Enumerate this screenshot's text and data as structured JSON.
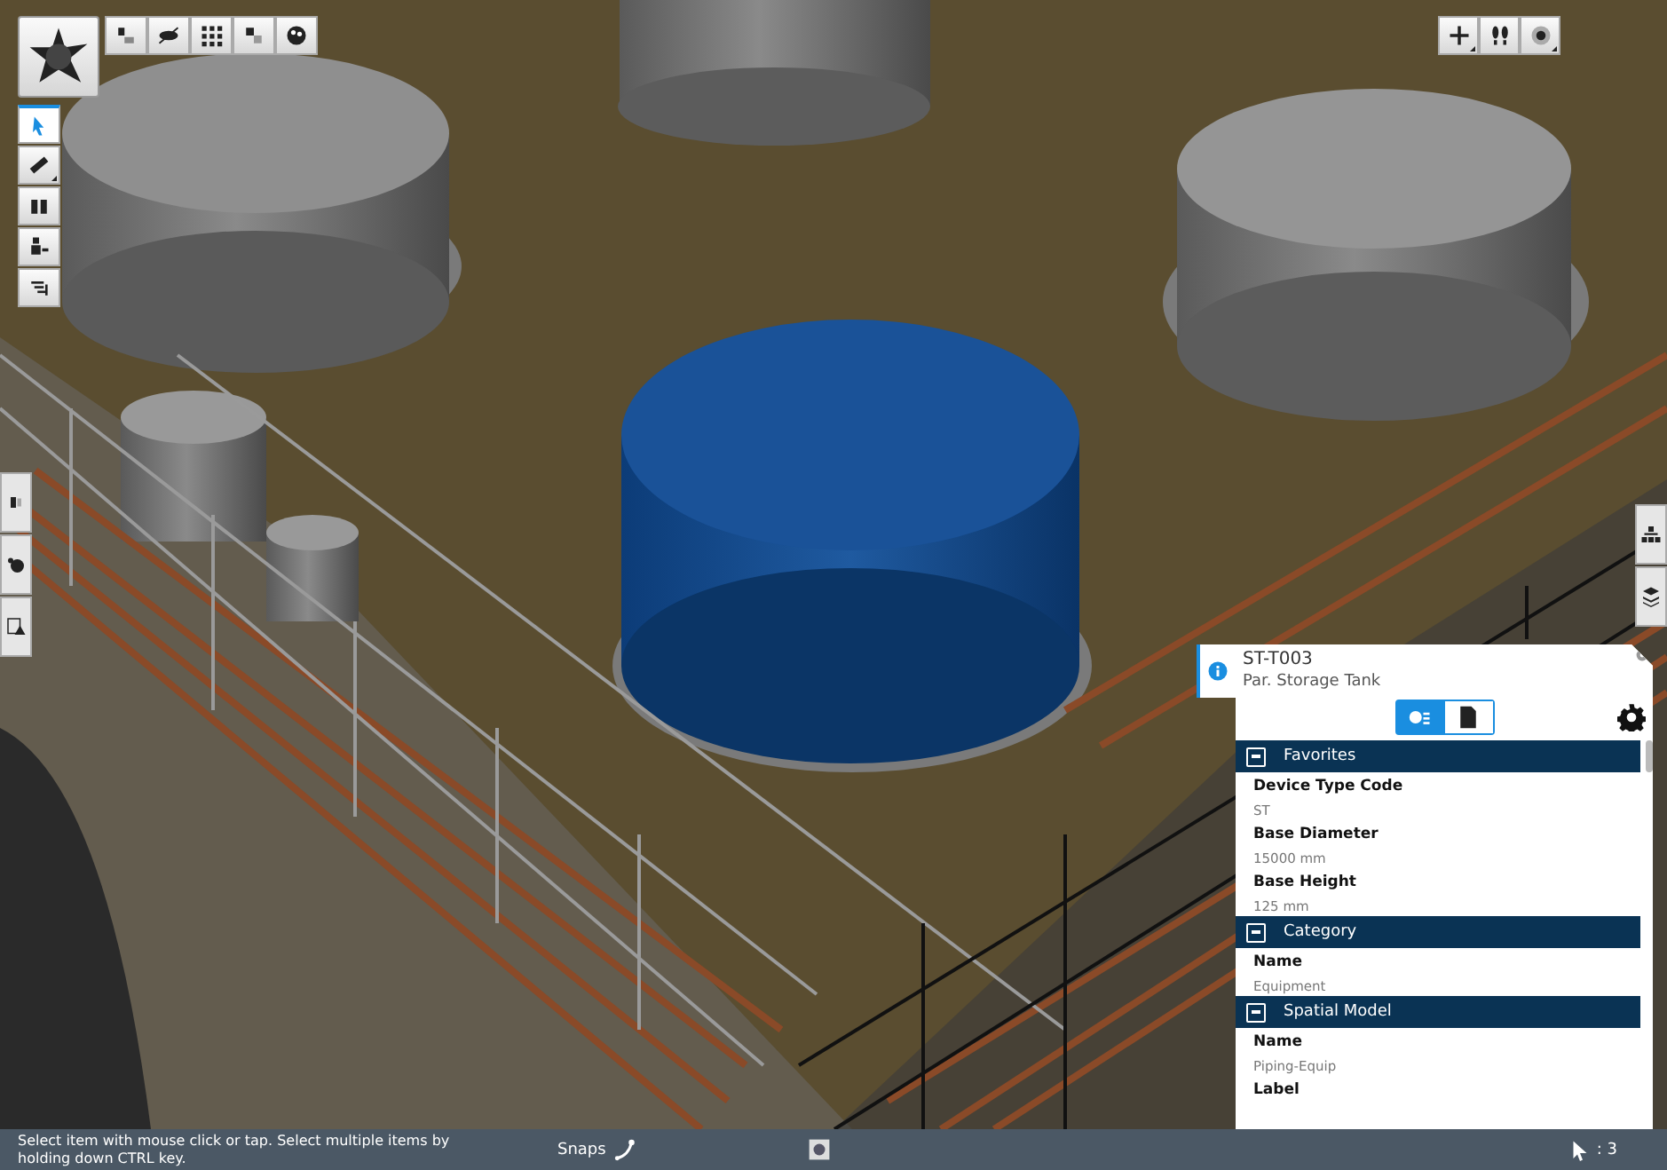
{
  "top_toolbar": [
    {
      "has_menu": false
    },
    {
      "has_menu": false
    },
    {
      "has_menu": false
    },
    {
      "has_menu": false
    },
    {
      "has_menu": false
    }
  ],
  "left_toolbar": [
    {
      "selected": true,
      "has_menu": false
    },
    {
      "selected": false,
      "has_menu": true
    },
    {
      "selected": false,
      "has_menu": false
    },
    {
      "selected": false,
      "has_menu": false
    },
    {
      "selected": false,
      "has_menu": false
    }
  ],
  "left_side_tabs": [
    {
      "selected": false
    },
    {
      "selected": false
    },
    {
      "selected": false
    }
  ],
  "right_side_tabs": [
    {
      "selected": false
    },
    {
      "selected": false
    }
  ],
  "view_toolbar": [
    {
      "has_menu": true
    },
    {
      "has_menu": false
    },
    {
      "has_menu": true
    }
  ],
  "properties_panel": {
    "title": "ST-T003",
    "subtitle": "Par. Storage Tank",
    "tabs": [
      {
        "selected": true
      },
      {
        "selected": false
      }
    ],
    "sections": [
      {
        "title": "Favorites",
        "expanded": true,
        "properties": [
          {
            "name": "Device Type Code",
            "value": "ST"
          },
          {
            "name": "Base Diameter",
            "value": "15000 mm"
          },
          {
            "name": "Base Height",
            "value": "125 mm"
          }
        ]
      },
      {
        "title": "Category",
        "expanded": true,
        "properties": [
          {
            "name": "Name",
            "value": "Equipment"
          }
        ]
      },
      {
        "title": "Spatial Model",
        "expanded": true,
        "properties": [
          {
            "name": "Name",
            "value": "Piping-Equip"
          },
          {
            "name": "Label"
          }
        ]
      }
    ]
  },
  "status_bar": {
    "hint": "Select item with mouse click or tap. Select multiple items by holding down CTRL key.",
    "snaps": "Snaps",
    "selection_count": ": 3"
  }
}
